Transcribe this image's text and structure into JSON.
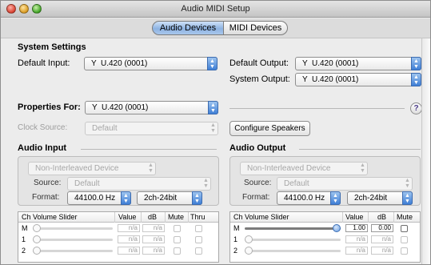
{
  "window": {
    "title": "Audio MIDI Setup"
  },
  "tabs": [
    {
      "label": "Audio Devices",
      "active": true
    },
    {
      "label": "MIDI Devices",
      "active": false
    }
  ],
  "system_settings": {
    "heading": "System Settings",
    "default_input_label": "Default Input:",
    "default_input_value": "U.420 (0001)",
    "default_output_label": "Default Output:",
    "default_output_value": "U.420 (0001)",
    "system_output_label": "System Output:",
    "system_output_value": "U.420 (0001)"
  },
  "properties": {
    "label": "Properties For:",
    "value": "U.420 (0001)",
    "clock_source_label": "Clock Source:",
    "clock_source_value": "Default",
    "configure_speakers": "Configure Speakers",
    "help": "?"
  },
  "audio_input": {
    "heading": "Audio Input",
    "device_type": "Non-Interleaved Device",
    "source_label": "Source:",
    "source_value": "Default",
    "format_label": "Format:",
    "rate": "44100.0 Hz",
    "channels": "2ch-24bit",
    "columns": [
      "Ch",
      "Volume Slider",
      "Value",
      "dB",
      "Mute",
      "Thru"
    ],
    "rows": [
      {
        "ch": "M",
        "value": "n/a",
        "db": "n/a",
        "active": false,
        "level": 0
      },
      {
        "ch": "1",
        "value": "n/a",
        "db": "n/a",
        "active": false,
        "level": 0
      },
      {
        "ch": "2",
        "value": "n/a",
        "db": "n/a",
        "active": false,
        "level": 0
      }
    ]
  },
  "audio_output": {
    "heading": "Audio Output",
    "device_type": "Non-Interleaved Device",
    "source_label": "Source:",
    "source_value": "Default",
    "format_label": "Format:",
    "rate": "44100.0 Hz",
    "channels": "2ch-24bit",
    "columns": [
      "Ch",
      "Volume Slider",
      "Value",
      "dB",
      "Mute"
    ],
    "rows": [
      {
        "ch": "M",
        "value": "1.00",
        "db": "0.00",
        "active": true,
        "level": 1.0
      },
      {
        "ch": "1",
        "value": "n/a",
        "db": "n/a",
        "active": false,
        "level": 0
      },
      {
        "ch": "2",
        "value": "n/a",
        "db": "n/a",
        "active": false,
        "level": 0
      }
    ]
  },
  "icons": {
    "device": "microphone-icon",
    "popup": "popup-arrows-icon"
  }
}
